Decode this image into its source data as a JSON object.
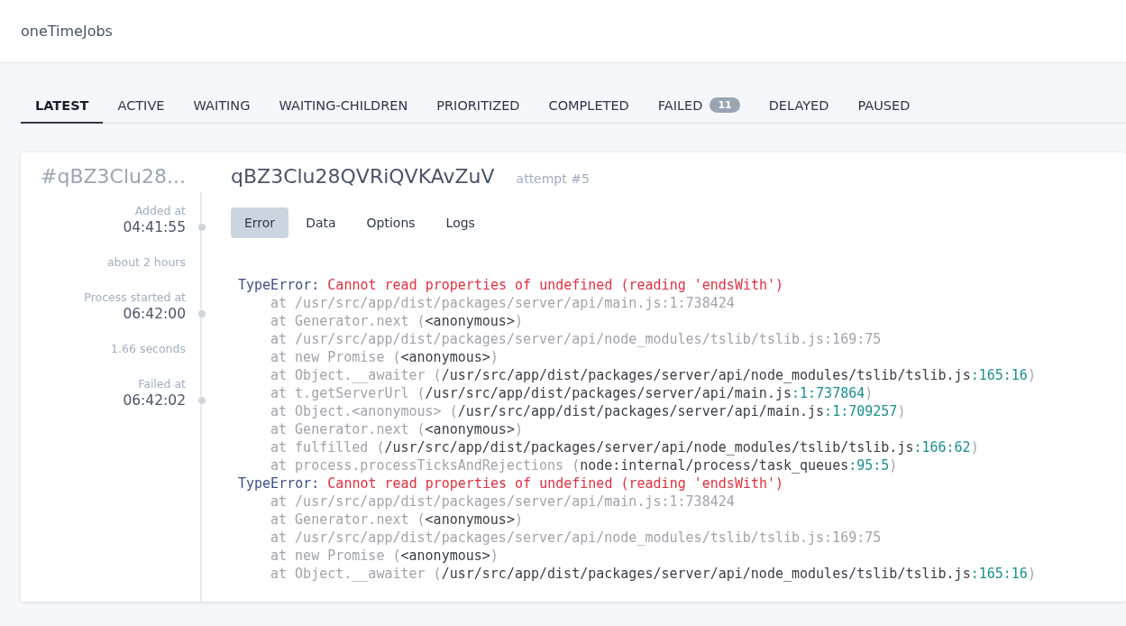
{
  "header": {
    "title": "oneTimeJobs"
  },
  "tabs": [
    {
      "label": "LATEST",
      "selected": true
    },
    {
      "label": "ACTIVE",
      "selected": false
    },
    {
      "label": "WAITING",
      "selected": false
    },
    {
      "label": "WAITING-CHILDREN",
      "selected": false
    },
    {
      "label": "PRIORITIZED",
      "selected": false
    },
    {
      "label": "COMPLETED",
      "selected": false
    },
    {
      "label": "FAILED",
      "selected": false,
      "badge": "11"
    },
    {
      "label": "DELAYED",
      "selected": false
    },
    {
      "label": "PAUSED",
      "selected": false
    }
  ],
  "job": {
    "short_id": "#qBZ3Clu28...",
    "id": "qBZ3Clu28QVRiQVKAvZuV",
    "attempt": "attempt #5",
    "timeline": [
      {
        "kind": "event",
        "label": "Added at",
        "time": "04:41:55"
      },
      {
        "kind": "duration",
        "label": "about 2 hours"
      },
      {
        "kind": "event",
        "label": "Process started at",
        "time": "06:42:00"
      },
      {
        "kind": "duration",
        "label": "1.66 seconds"
      },
      {
        "kind": "event",
        "label": "Failed at",
        "time": "06:42:02"
      }
    ],
    "detail_tabs": [
      {
        "label": "Error",
        "selected": true
      },
      {
        "label": "Data",
        "selected": false
      },
      {
        "label": "Options",
        "selected": false
      },
      {
        "label": "Logs",
        "selected": false
      }
    ],
    "stack_lines": [
      {
        "kind": "error",
        "segments": [
          {
            "kind": "type",
            "text": "TypeError:"
          },
          {
            "kind": "message",
            "text": " Cannot read properties of undefined (reading 'endsWith')"
          }
        ]
      },
      {
        "kind": "frame",
        "segments": [
          {
            "kind": "muted",
            "text": "at /usr/src/app/dist/packages/server/api/main.js:1:738424"
          }
        ]
      },
      {
        "kind": "frame",
        "segments": [
          {
            "kind": "muted",
            "text": "at Generator.next ("
          },
          {
            "kind": "path",
            "text": "<anonymous>"
          },
          {
            "kind": "muted",
            "text": ")"
          }
        ]
      },
      {
        "kind": "frame",
        "segments": [
          {
            "kind": "muted",
            "text": "at /usr/src/app/dist/packages/server/api/node_modules/tslib/tslib.js:169:75"
          }
        ]
      },
      {
        "kind": "frame",
        "segments": [
          {
            "kind": "muted",
            "text": "at new Promise ("
          },
          {
            "kind": "path",
            "text": "<anonymous>"
          },
          {
            "kind": "muted",
            "text": ")"
          }
        ]
      },
      {
        "kind": "frame",
        "segments": [
          {
            "kind": "muted",
            "text": "at Object.__awaiter ("
          },
          {
            "kind": "path",
            "text": "/usr/src/app/dist/packages/server/api/node_modules/tslib/tslib.js"
          },
          {
            "kind": "location",
            "text": ":165:16"
          },
          {
            "kind": "muted",
            "text": ")"
          }
        ]
      },
      {
        "kind": "frame",
        "segments": [
          {
            "kind": "muted",
            "text": "at t.getServerUrl ("
          },
          {
            "kind": "path",
            "text": "/usr/src/app/dist/packages/server/api/main.js"
          },
          {
            "kind": "location",
            "text": ":1:737864"
          },
          {
            "kind": "muted",
            "text": ")"
          }
        ]
      },
      {
        "kind": "frame",
        "segments": [
          {
            "kind": "muted",
            "text": "at Object.<anonymous> ("
          },
          {
            "kind": "path",
            "text": "/usr/src/app/dist/packages/server/api/main.js"
          },
          {
            "kind": "location",
            "text": ":1:709257"
          },
          {
            "kind": "muted",
            "text": ")"
          }
        ]
      },
      {
        "kind": "frame",
        "segments": [
          {
            "kind": "muted",
            "text": "at Generator.next ("
          },
          {
            "kind": "path",
            "text": "<anonymous>"
          },
          {
            "kind": "muted",
            "text": ")"
          }
        ]
      },
      {
        "kind": "frame",
        "segments": [
          {
            "kind": "muted",
            "text": "at fulfilled ("
          },
          {
            "kind": "path",
            "text": "/usr/src/app/dist/packages/server/api/node_modules/tslib/tslib.js"
          },
          {
            "kind": "location",
            "text": ":166:62"
          },
          {
            "kind": "muted",
            "text": ")"
          }
        ]
      },
      {
        "kind": "frame",
        "segments": [
          {
            "kind": "muted",
            "text": "at process.processTicksAndRejections ("
          },
          {
            "kind": "path",
            "text": "node:internal/process/task_queues"
          },
          {
            "kind": "location",
            "text": ":95:5"
          },
          {
            "kind": "muted",
            "text": ")"
          }
        ]
      },
      {
        "kind": "error",
        "segments": [
          {
            "kind": "type",
            "text": "TypeError:"
          },
          {
            "kind": "message",
            "text": " Cannot read properties of undefined (reading 'endsWith')"
          }
        ]
      },
      {
        "kind": "frame",
        "segments": [
          {
            "kind": "muted",
            "text": "at /usr/src/app/dist/packages/server/api/main.js:1:738424"
          }
        ]
      },
      {
        "kind": "frame",
        "segments": [
          {
            "kind": "muted",
            "text": "at Generator.next ("
          },
          {
            "kind": "path",
            "text": "<anonymous>"
          },
          {
            "kind": "muted",
            "text": ")"
          }
        ]
      },
      {
        "kind": "frame",
        "segments": [
          {
            "kind": "muted",
            "text": "at /usr/src/app/dist/packages/server/api/node_modules/tslib/tslib.js:169:75"
          }
        ]
      },
      {
        "kind": "frame",
        "segments": [
          {
            "kind": "muted",
            "text": "at new Promise ("
          },
          {
            "kind": "path",
            "text": "<anonymous>"
          },
          {
            "kind": "muted",
            "text": ")"
          }
        ]
      },
      {
        "kind": "frame",
        "segments": [
          {
            "kind": "muted",
            "text": "at Object.__awaiter ("
          },
          {
            "kind": "path",
            "text": "/usr/src/app/dist/packages/server/api/node_modules/tslib/tslib.js"
          },
          {
            "kind": "location",
            "text": ":165:16"
          },
          {
            "kind": "muted",
            "text": ")"
          }
        ]
      }
    ]
  }
}
